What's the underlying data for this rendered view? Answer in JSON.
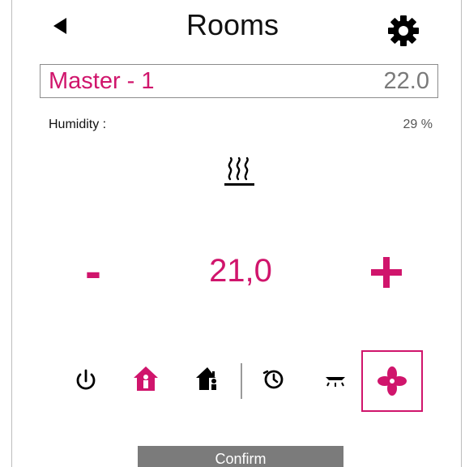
{
  "header": {
    "title": "Rooms",
    "back_icon": "back-arrow-icon",
    "settings_icon": "gear-icon"
  },
  "room": {
    "name": "Master - 1",
    "current_temp": "22.0"
  },
  "humidity": {
    "label": "Humidity :",
    "value": "29 %"
  },
  "mode_indicator_icon": "heating-icon",
  "setpoint": {
    "minus_label": "-",
    "value": "21,0",
    "plus_icon": "plus-icon"
  },
  "modes": [
    {
      "icon": "power-icon",
      "active": false
    },
    {
      "icon": "home-occupied-icon",
      "active": true
    },
    {
      "icon": "home-away-icon",
      "active": false
    },
    {
      "icon": "schedule-clock-icon",
      "active": false
    },
    {
      "icon": "night-mode-icon",
      "active": false
    },
    {
      "icon": "fan-icon",
      "active": true,
      "selected": true
    }
  ],
  "footer": {
    "confirm_label": "Confirm"
  },
  "colors": {
    "accent": "#d0156c",
    "button_gray": "#7b7b7b"
  }
}
